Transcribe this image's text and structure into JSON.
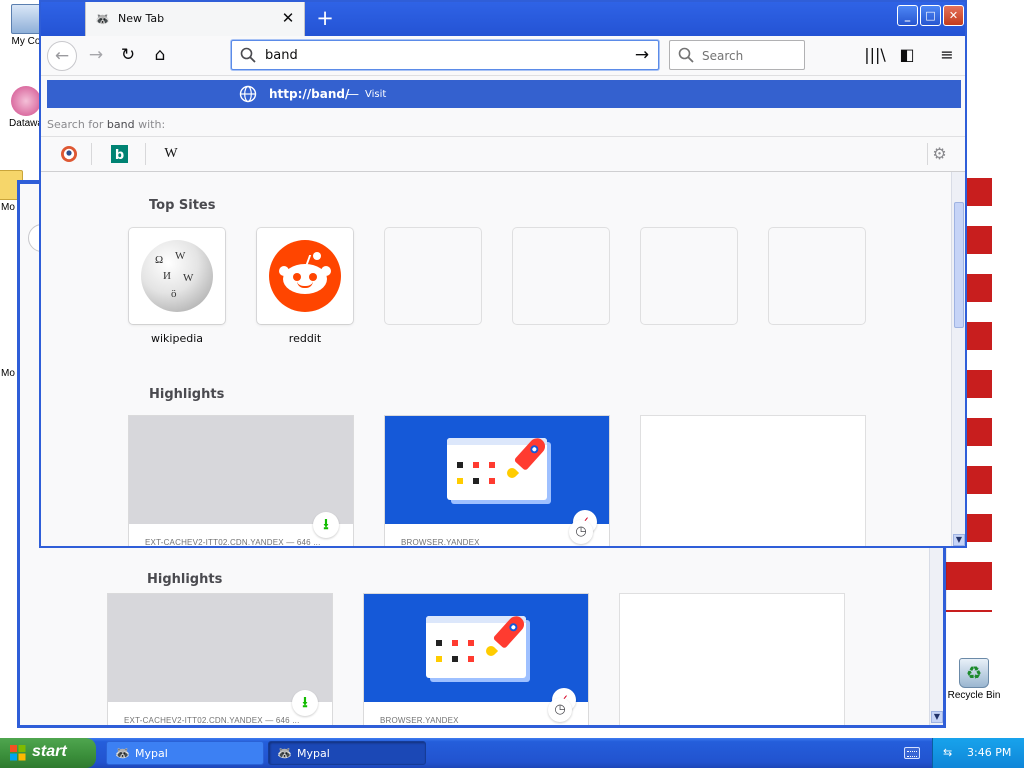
{
  "desktop": {
    "icons": [
      {
        "label": "My Co",
        "icon": "my-computer-icon"
      },
      {
        "label": "Datawa",
        "icon": "shortcut-icon"
      },
      {
        "label": "Mo",
        "icon": "folder-icon"
      },
      {
        "label": "Mo",
        "icon": "folder-icon"
      },
      {
        "label": "Recycle Bin",
        "icon": "recycle-bin-icon"
      }
    ]
  },
  "background_window": {
    "highlights_title": "Highlights",
    "cards": [
      {
        "caption": "EXT-CACHEV2-ITT02.CDN.YANDEX — 646 ...",
        "badge": "download-icon"
      },
      {
        "caption": "BROWSER.YANDEX",
        "badge": "pocket-icon"
      },
      {
        "caption": ""
      }
    ]
  },
  "browser": {
    "tab": {
      "title": "New Tab",
      "close": "✕"
    },
    "new_tab_symbol": "+",
    "window_controls": {
      "minimize": "_",
      "maximize": "□",
      "close": "✕"
    },
    "nav": {
      "back": "←",
      "forward": "→",
      "reload": "↻",
      "home": "⌂"
    },
    "urlbar": {
      "value": "band",
      "go": "→"
    },
    "searchbar": {
      "placeholder": "Search"
    },
    "toolbar": {
      "library": "|||\\",
      "sidebar": "◧",
      "menu": "≡"
    }
  },
  "autocomplete": {
    "suggestion": {
      "url": "http://band/",
      "dash": "—",
      "action": "Visit"
    },
    "search_for_prefix": "Search for ",
    "search_for_term": "band",
    "search_for_suffix": " with:",
    "engines": [
      {
        "name": "DuckDuckGo",
        "icon": "duckduckgo-icon"
      },
      {
        "name": "Bing",
        "icon": "bing-icon",
        "glyph": "b"
      },
      {
        "name": "Wikipedia",
        "icon": "wikipedia-icon",
        "glyph": "W"
      }
    ],
    "settings": "⚙"
  },
  "newtab": {
    "top_sites_title": "Top Sites",
    "top_sites": [
      {
        "label": "wikipedia"
      },
      {
        "label": "reddit"
      },
      {
        "label": ""
      },
      {
        "label": ""
      },
      {
        "label": ""
      },
      {
        "label": ""
      }
    ],
    "highlights_title": "Highlights",
    "highlights": [
      {
        "caption": "EXT-CACHEV2-ITT02.CDN.YANDEX — 646 ...",
        "badge": "download-icon"
      },
      {
        "caption": "BROWSER.YANDEX",
        "badge": "pocket-icon"
      },
      {
        "caption": ""
      }
    ]
  },
  "taskbar": {
    "start_label": "start",
    "tasks": [
      {
        "label": "Mypal",
        "active": false
      },
      {
        "label": "Mypal",
        "active": true
      }
    ],
    "clock": "3:46 PM"
  },
  "colors": {
    "xp_blue": "#2f5ed8",
    "highlight_row": "#3461cf",
    "reddit": "#ff4500",
    "yandex_blue": "#1559d8",
    "download_green": "#12bc00",
    "pocket_red": "#d70022"
  }
}
